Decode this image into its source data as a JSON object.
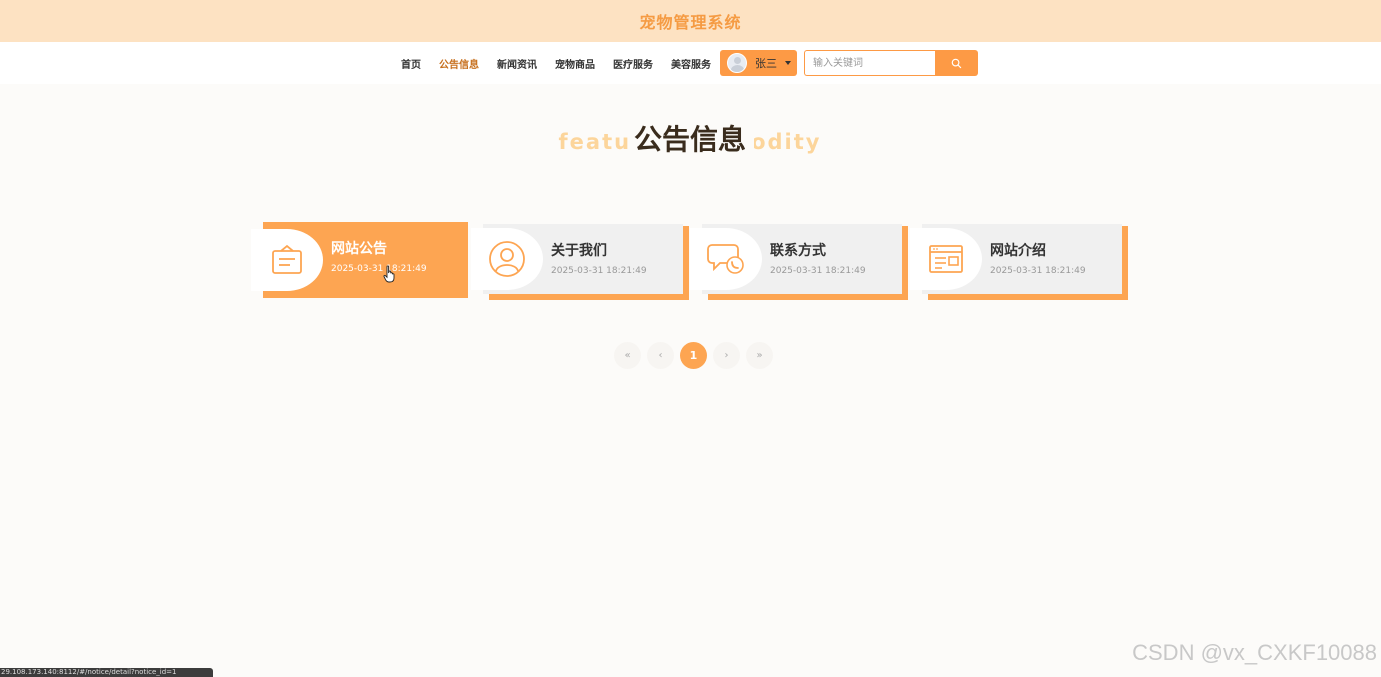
{
  "header": {
    "site_title": "宠物管理系统"
  },
  "nav": {
    "items": [
      {
        "label": "首页",
        "active": false
      },
      {
        "label": "公告信息",
        "active": true
      },
      {
        "label": "新闻资讯",
        "active": false
      },
      {
        "label": "宠物商品",
        "active": false
      },
      {
        "label": "医疗服务",
        "active": false
      },
      {
        "label": "美容服务",
        "active": false
      }
    ],
    "user_name": "张三",
    "search_placeholder": "输入关键词"
  },
  "section": {
    "title": "公告信息",
    "subtitle_left": "featu",
    "subtitle_right": "odity"
  },
  "notices": [
    {
      "title": "网站公告",
      "date": "2025-03-31 18:21:49",
      "icon": "notice-board-icon",
      "active": true
    },
    {
      "title": "关于我们",
      "date": "2025-03-31 18:21:49",
      "icon": "user-circle-icon",
      "active": false
    },
    {
      "title": "联系方式",
      "date": "2025-03-31 18:21:49",
      "icon": "chat-phone-icon",
      "active": false
    },
    {
      "title": "网站介绍",
      "date": "2025-03-31 18:21:49",
      "icon": "browser-window-icon",
      "active": false
    }
  ],
  "pagination": {
    "first": "«",
    "prev": "‹",
    "current": "1",
    "next": "›",
    "last": "»"
  },
  "status_bar": {
    "url": "29.108.173.140:8112/#/notice/detail?notice_id=1"
  },
  "watermark": "CSDN @vx_CXKF10088",
  "colors": {
    "accent": "#fda552",
    "header_bg": "#fde2c2",
    "title_orange": "#f59b43"
  }
}
